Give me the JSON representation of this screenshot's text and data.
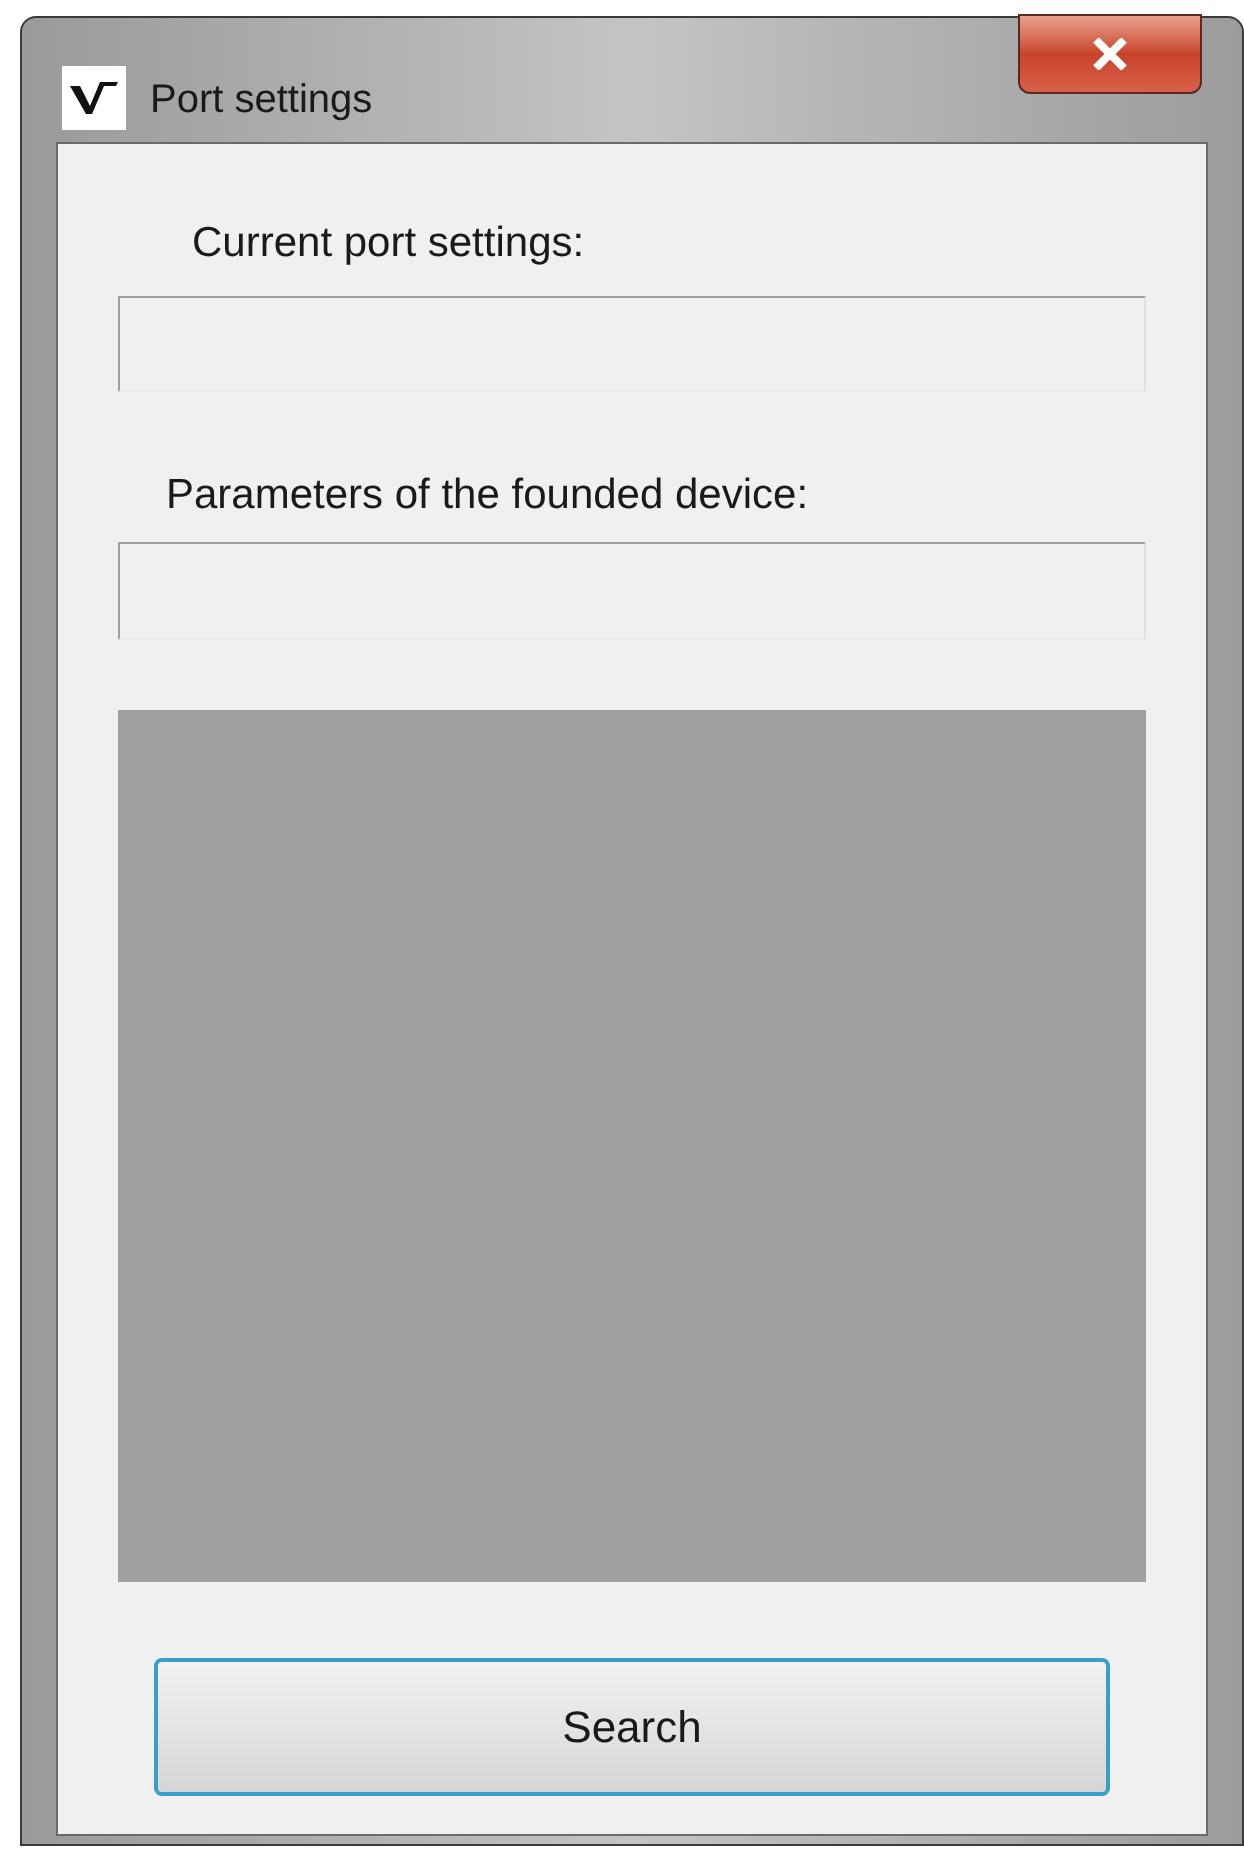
{
  "window": {
    "title": "Port settings"
  },
  "current_port_settings": {
    "label": "Current port settings:"
  },
  "device_parameters": {
    "label": "Parameters of the founded device:"
  },
  "buttons": [
    {
      "label": "Search",
      "focused": true
    }
  ]
}
